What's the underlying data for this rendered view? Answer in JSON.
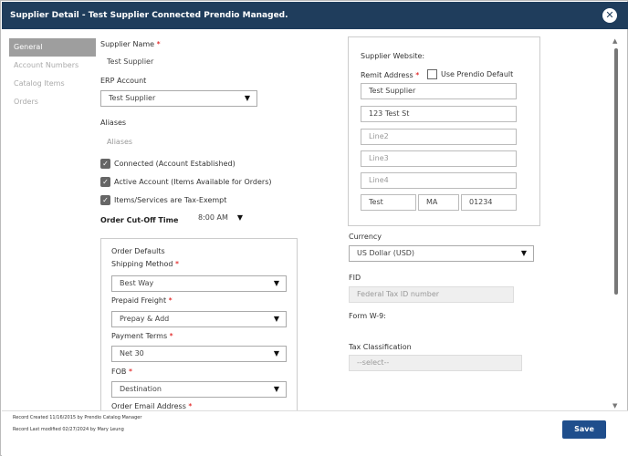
{
  "title": "Supplier Detail - Test Supplier Connected Prendio Managed.",
  "sidebar": {
    "items": [
      {
        "label": "General"
      },
      {
        "label": "Account Numbers"
      },
      {
        "label": "Catalog Items"
      },
      {
        "label": "Orders"
      }
    ]
  },
  "form": {
    "supplier_name_label": "Supplier Name",
    "supplier_name_value": "Test Supplier",
    "erp_label": "ERP Account",
    "erp_value": "Test Supplier",
    "aliases_label": "Aliases",
    "aliases_value": "Aliases",
    "cb_connected": "Connected (Account Established)",
    "cb_active": "Active Account (Items Available for Orders)",
    "cb_tax": "Items/Services are Tax-Exempt",
    "cutoff_label": "Order Cut-Off Time",
    "cutoff_value": "8:00 AM"
  },
  "order_defaults": {
    "heading": "Order Defaults",
    "shipping_label": "Shipping Method",
    "shipping_value": "Best Way",
    "prepaid_label": "Prepaid Freight",
    "prepaid_value": "Prepay & Add",
    "terms_label": "Payment Terms",
    "terms_value": "Net 30",
    "fob_label": "FOB",
    "fob_value": "Destination",
    "email_label": "Order Email Address"
  },
  "address": {
    "website_label": "Supplier Website:",
    "remit_label": "Remit Address",
    "use_default_label": "Use Prendio Default",
    "line1": "Test Supplier",
    "line2": "123 Test St",
    "line3_placeholder": "Line2",
    "line4_placeholder": "Line3",
    "line5_placeholder": "Line4",
    "city": "Test",
    "state": "MA",
    "zip": "01234"
  },
  "right": {
    "currency_label": "Currency",
    "currency_value": "US Dollar (USD)",
    "fid_label": "FID",
    "fid_placeholder": "Federal Tax ID number",
    "w9_label": "Form W-9:",
    "tax_class_label": "Tax Classification",
    "tax_class_value": "--select--"
  },
  "footer": {
    "created": "Record Created 11/16/2015 by Prendio Catalog Manager",
    "modified": "Record Last modified 02/27/2024 by Mary Leung",
    "save_label": "Save"
  },
  "required_mark": "*",
  "check_mark": "✓",
  "caret": "▼"
}
